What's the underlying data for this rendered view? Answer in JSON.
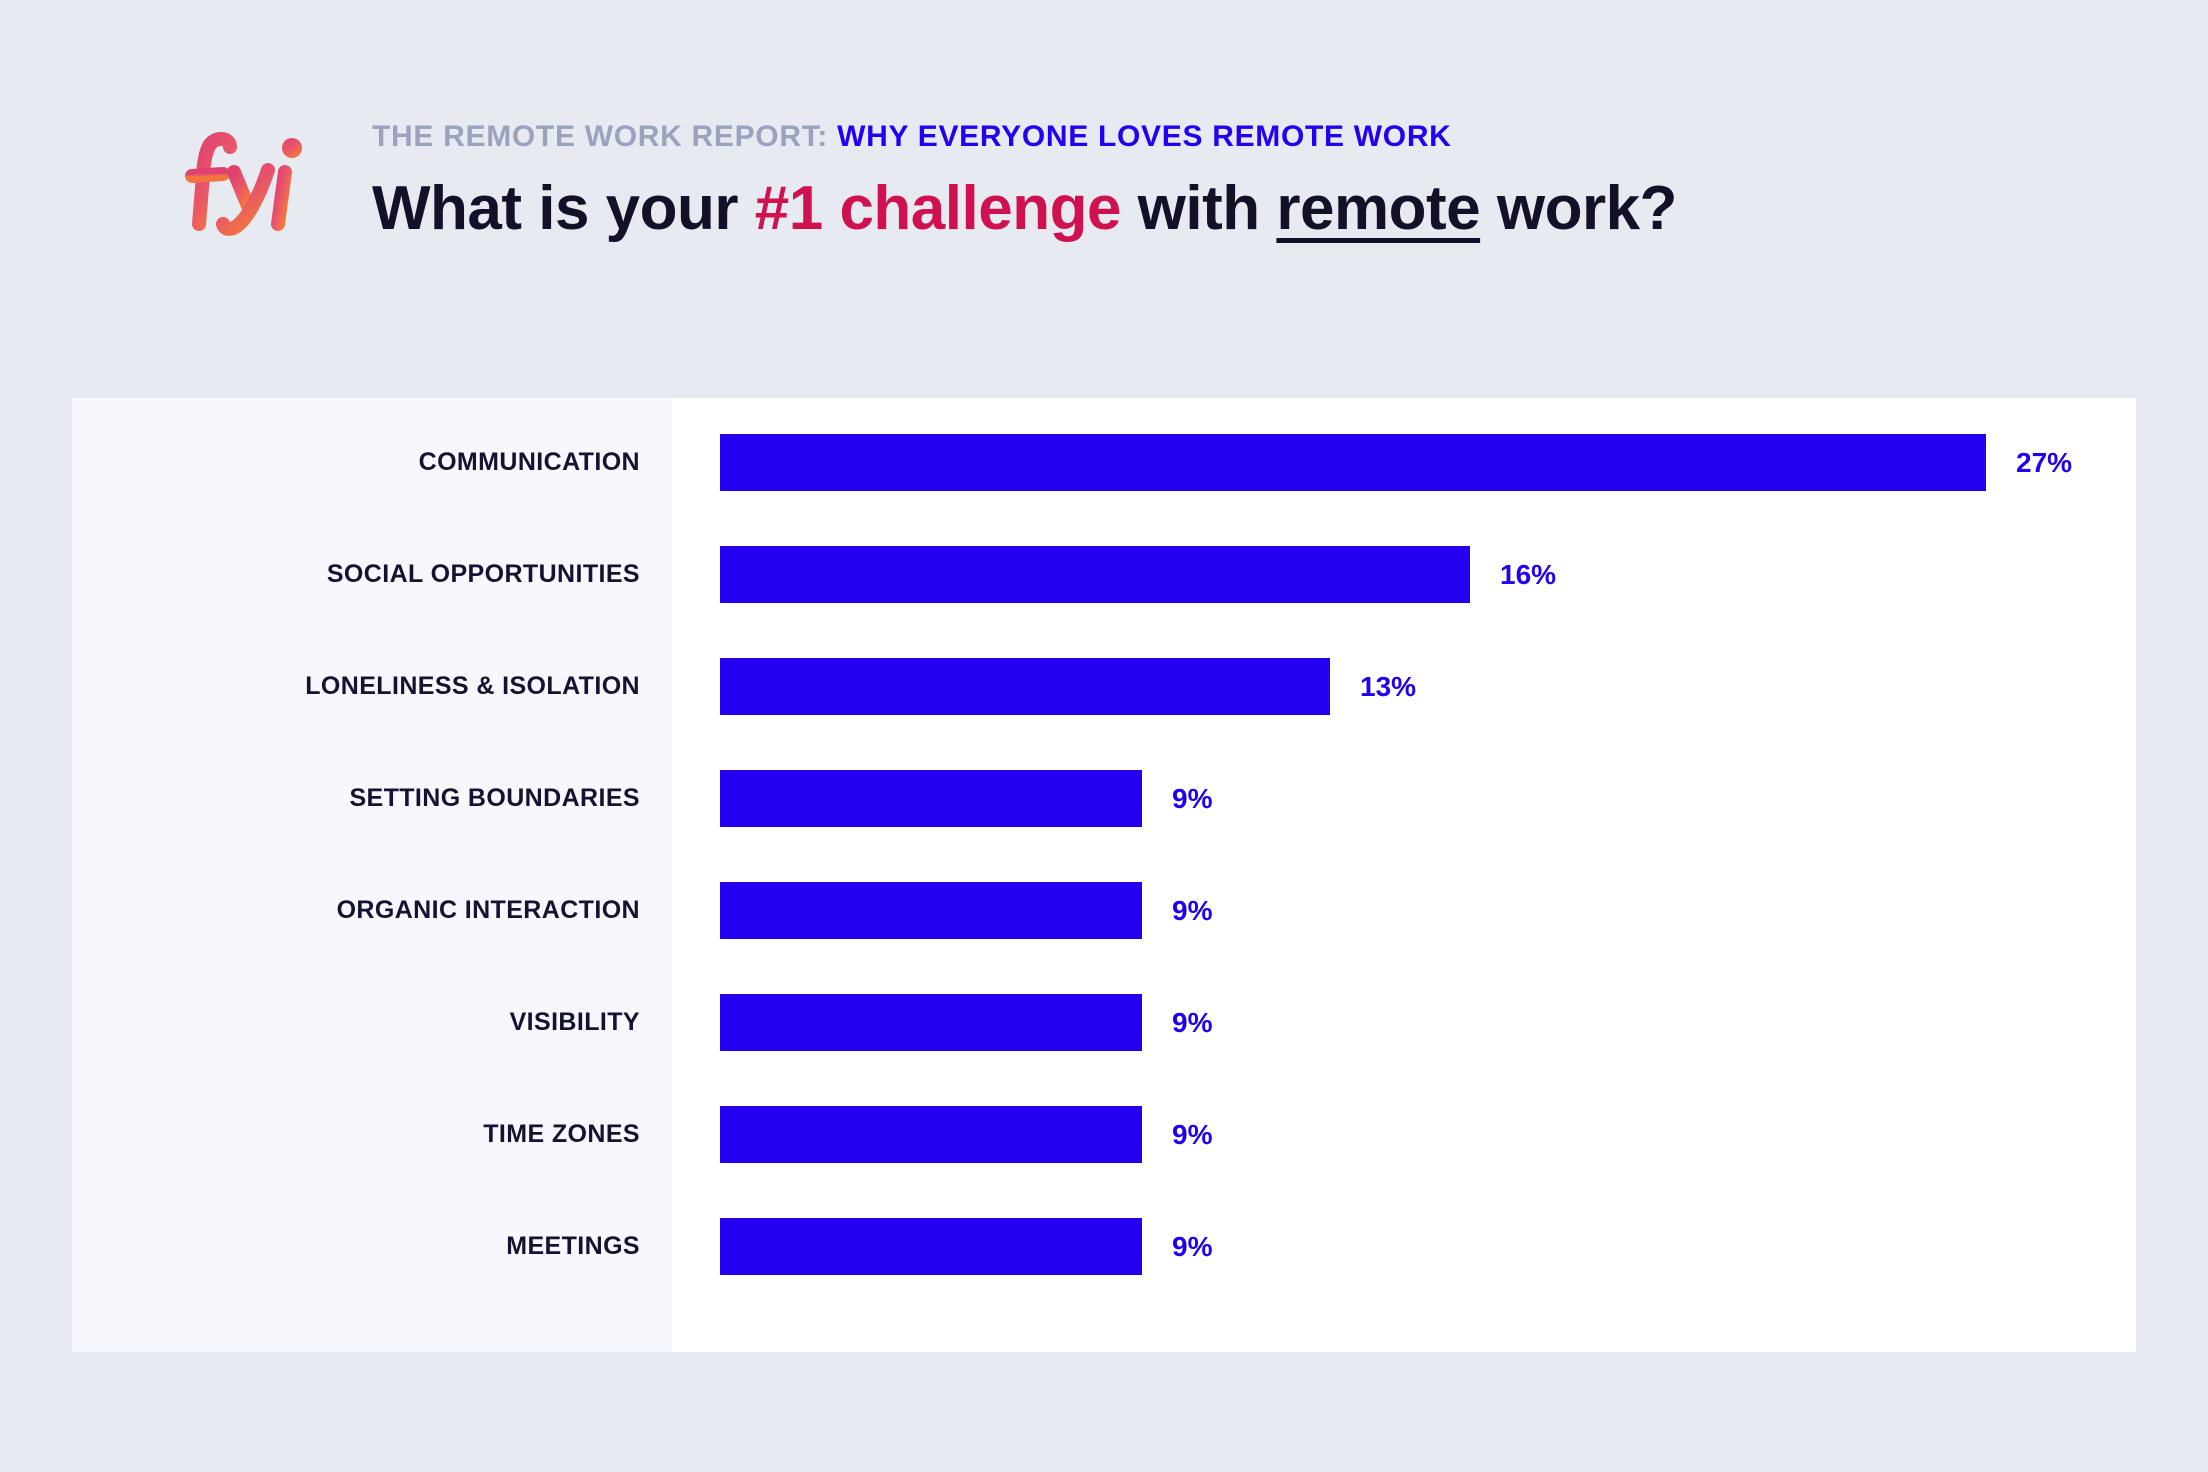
{
  "header": {
    "logo_text": "fyi",
    "kicker": "THE REMOTE WORK REPORT:",
    "kicker_accent": "WHY EVERYONE LOVES REMOTE WORK",
    "title_part1": "What is your ",
    "title_highlight": "#1 challenge",
    "title_part2": " with ",
    "title_underlined": "remote",
    "title_part3": " work?"
  },
  "colors": {
    "page_background": "#e8eaf2",
    "panel_background": "#ffffff",
    "label_column_background": "#f7f8fd",
    "bar": "#2400f0",
    "accent_blue": "#2400f0",
    "accent_crimson": "#d0114f",
    "kicker_gray": "#9ba2bd",
    "title_dark": "#121127",
    "logo_gradient_start": "#e0416f",
    "logo_gradient_end": "#f2753e"
  },
  "chart_data": {
    "type": "bar",
    "orientation": "horizontal",
    "title": "What is your #1 challenge with remote work?",
    "subtitle": "THE REMOTE WORK REPORT: WHY EVERYONE LOVES REMOTE WORK",
    "xlabel": "",
    "ylabel": "",
    "grid": false,
    "legend": false,
    "value_suffix": "%",
    "xlim": [
      0,
      30
    ],
    "categories": [
      "COMMUNICATION",
      "SOCIAL OPPORTUNITIES",
      "LONELINESS & ISOLATION",
      "SETTING BOUNDARIES",
      "ORGANIC INTERACTION",
      "VISIBILITY",
      "TIME ZONES",
      "MEETINGS"
    ],
    "values": [
      27,
      16,
      13,
      9,
      9,
      9,
      9,
      9
    ],
    "value_labels": [
      "27%",
      "16%",
      "13%",
      "9%",
      "9%",
      "9%",
      "9%",
      "9%"
    ]
  }
}
